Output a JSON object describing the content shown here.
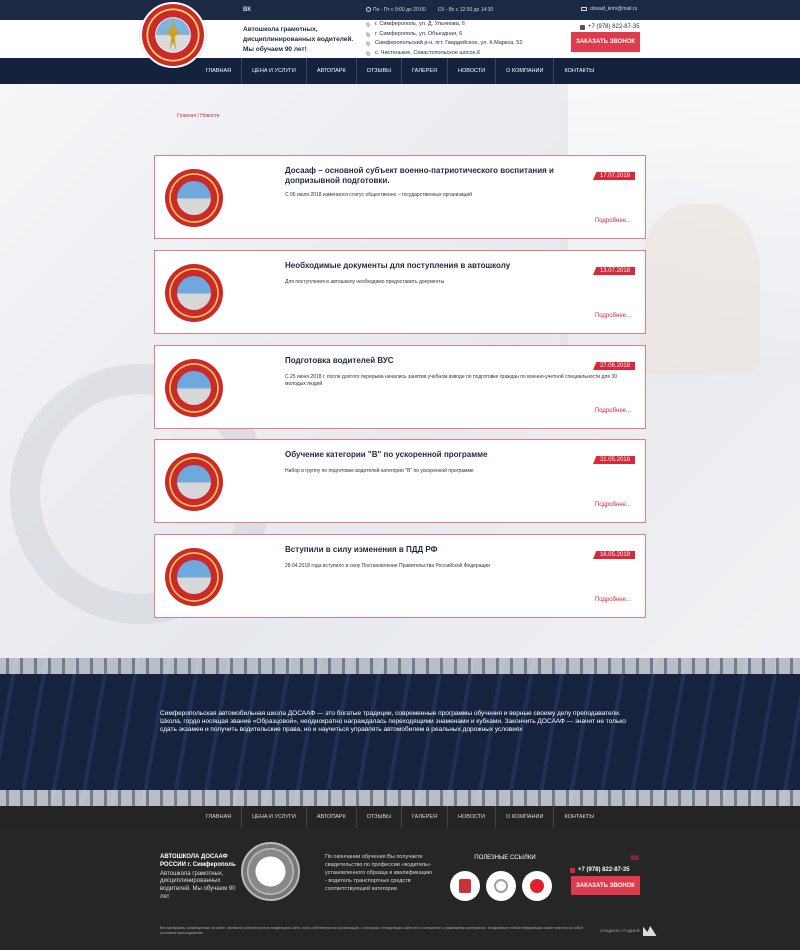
{
  "topbar": {
    "vk": "ВК",
    "hours_weekdays": "Пн - Пт с 9:00 до 20:00",
    "hours_weekend": "Сб - Вс с 12:30 до 14:30",
    "email": "dosaaf_krim@mail.ru"
  },
  "header": {
    "tagline": "Автошкола грамотных, дисциплинированных водителей. Мы обучаем 90 лет!",
    "addresses": [
      "г. Симферополь, ул. Д. Ульянова, 6",
      "г. Симферополь, ул. Объездная, 6",
      "Симферопольский р-н, пгт. Гвардейское, ул. К.Маркса, 52",
      "с. Чистенькое, Севастопольское шоссе,6"
    ],
    "phone": "+7 (978) 822-87-35",
    "call_button": "ЗАКАЗАТЬ ЗВОНОК"
  },
  "nav": {
    "items": [
      "ГЛАВНАЯ",
      "ЦЕНА И УСЛУГИ",
      "АВТОПАРК",
      "ОТЗЫВЫ",
      "ГАЛЕРЕЯ",
      "НОВОСТИ",
      "О КОМПАНИИ",
      "КОНТАКТЫ"
    ]
  },
  "breadcrumb": {
    "home": "Главная",
    "sep": " / ",
    "current": "Новости"
  },
  "news": [
    {
      "title": "Досааф – основной субъект военно-патриотического воспитания и допризывной подготовки.",
      "date": "17.07.2018",
      "excerpt": "С 06 июля 2018 изменился статус общественно – государственных организаций",
      "more": "Подробнее..."
    },
    {
      "title": "Необходимые документы для поступления в автошколу",
      "date": "13.07.2018",
      "excerpt": "Для поступления в автошколу необходимо предоставить документы",
      "more": "Подробнее..."
    },
    {
      "title": "Подготовка водителей ВУС",
      "date": "27.06.2018",
      "excerpt": "С 25 июня 2018 г. после долгого перерыва начались занятия учебном взводе по подготовке граждан по военно-учетной специальности для 30 молодых людей",
      "more": "Подробнее..."
    },
    {
      "title": "Обучение категории \"В\" по ускоренной программе",
      "date": "31.05.2018",
      "excerpt": "Набор в группу по подготовке водителей категории \"В\" по ускоренной программе",
      "more": "Подробнее..."
    },
    {
      "title": "Вступили в силу изменения в ПДД РФ",
      "date": "16.05.2018",
      "excerpt": "28.04.2018 года вступило в силу Постановление Правительства Российской Федерации",
      "more": "Подробнее..."
    }
  ],
  "about": "Симферопольская автомобильная школа ДОСААФ — это богатые традиции, современные программы обучения и верные своему делу преподаватели. Школа, гордо носящая звание «Образцовой», неоднократно награждалась переходящими знаменами и кубками. Закончить ДОСААФ — значит не только сдать экзамен и получить водительские права, но и научиться управлять автомобилем в реальных дорожных условиях",
  "footer": {
    "brand_name": "АВТОШКОЛА ДОСААФ РОССИИ г. Симферополь",
    "brand_desc": "Автошкола грамотных, дисциплинированных водителей. Мы обучаем 90 лет",
    "note": "По окончании обучения Вы получаете свидетельство по профессии «водитель» установленного образца и квалификацию - водитель транспортных средств соответствующей категории.",
    "links_head": "ПОЛЕЗНЫЕ ССЫЛКИ",
    "phone": "+7 (978) 822-87-35",
    "vk": "ВК",
    "call_button": "ЗАКАЗАТЬ ЗВОНОК",
    "legal": "Все материалы, размещенные на сайте, являются собственностью владельцев сайта, либо собственностью организаций, с которыми у владельцев сайта есть соглашение о размещении материалов. Копирование любой информации может повлечь за собой уголовное преследование.",
    "made_by": "СОЗДАНО СТУДИЕЙ"
  },
  "colors": {
    "navy": "#13233e",
    "accent_red": "#e03a4d",
    "footer_bg": "#262626"
  }
}
